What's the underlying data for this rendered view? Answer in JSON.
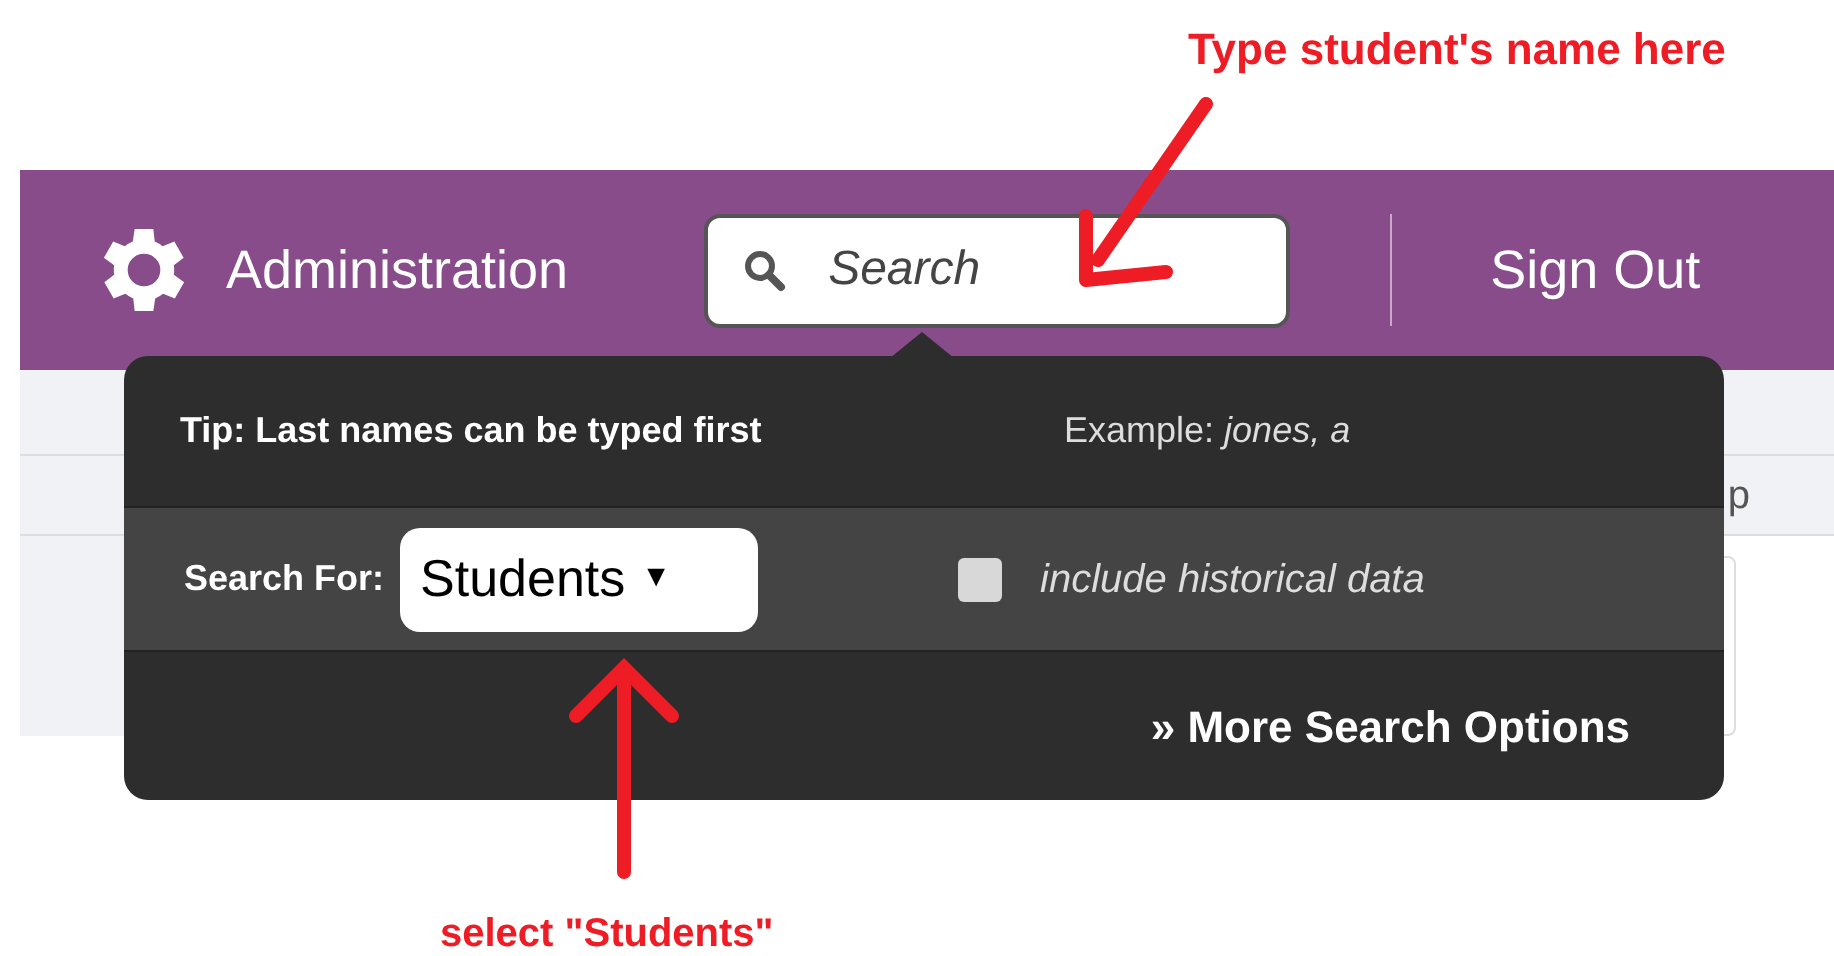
{
  "annotations": [
    {
      "text": "Type student's name here"
    },
    {
      "text": "select \"Students\""
    }
  ],
  "nav": {
    "title": "Administration",
    "search": {
      "placeholder": "Search"
    },
    "sign_out": "Sign Out"
  },
  "background_fragment": "p",
  "popover": {
    "tip": "Tip: Last names can be typed first",
    "example": "Example: *jones, a*",
    "search_for_label": "Search For:",
    "search_for_value": "Students",
    "search_for_caret": "▼",
    "historical": {
      "label": "include historical data",
      "checked": false
    },
    "more": "» More Search Options"
  }
}
